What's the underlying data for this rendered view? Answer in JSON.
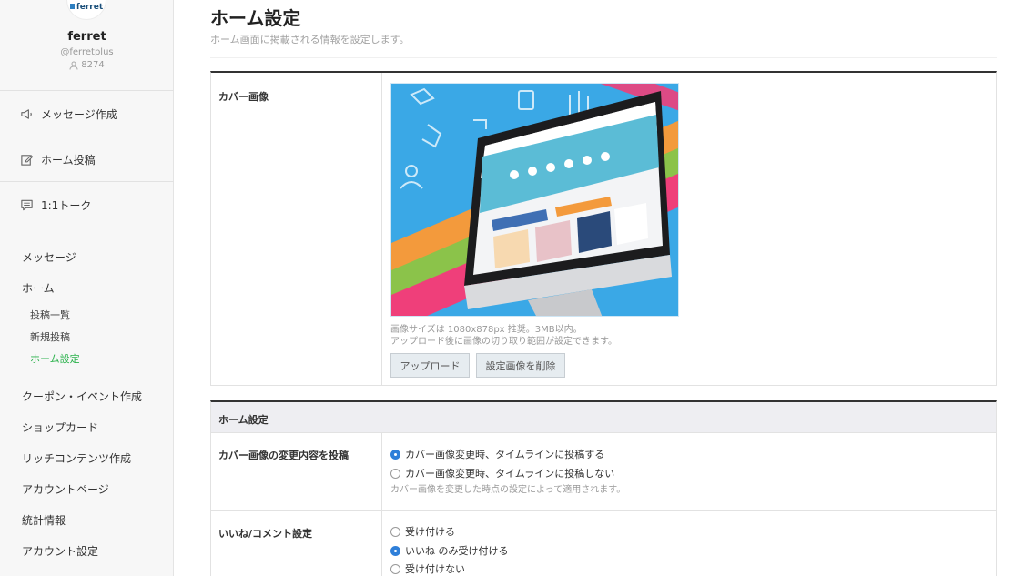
{
  "account": {
    "logo_text": "ferret",
    "name": "ferret",
    "handle": "@ferretplus",
    "followers": "8274"
  },
  "sidebar": {
    "actions": [
      {
        "label": "メッセージ作成",
        "icon": "megaphone-icon"
      },
      {
        "label": "ホーム投稿",
        "icon": "edit-icon"
      },
      {
        "label": "1:1トーク",
        "icon": "chat-icon"
      }
    ],
    "menu": {
      "message": "メッセージ",
      "home": "ホーム",
      "home_sub": [
        "投稿一覧",
        "新規投稿",
        "ホーム設定"
      ],
      "active_sub": "ホーム設定",
      "coupon": "クーポン・イベント作成",
      "shopcard": "ショップカード",
      "rich": "リッチコンテンツ作成",
      "account_page": "アカウントページ",
      "stats": "統計情報",
      "account_settings": "アカウント設定"
    },
    "active_color": "#2bb24c"
  },
  "header": {
    "title": "ホーム設定",
    "subtitle": "ホーム画面に掲載される情報を設定します。"
  },
  "cover": {
    "label": "カバー画像",
    "hint1": "画像サイズは 1080x878px 推奨。3MB以内。",
    "hint2": "アップロード後に画像の切り取り範囲が設定できます。",
    "upload_button": "アップロード",
    "delete_button": "設定画像を削除"
  },
  "home_settings": {
    "section_title": "ホーム設定",
    "post_change": {
      "label": "カバー画像の変更内容を投稿",
      "options": [
        "カバー画像変更時、タイムラインに投稿する",
        "カバー画像変更時、タイムラインに投稿しない"
      ],
      "selected": 0,
      "hint": "カバー画像を変更した時点の設定によって適用されます。"
    },
    "like_comment": {
      "label": "いいね/コメント設定",
      "options": [
        "受け付ける",
        "いいね のみ受け付ける",
        "受け付けない"
      ],
      "selected": 1
    }
  },
  "colors": {
    "radio_selected": "#2e7fd9",
    "cover_bg": "#3aa8e6"
  }
}
